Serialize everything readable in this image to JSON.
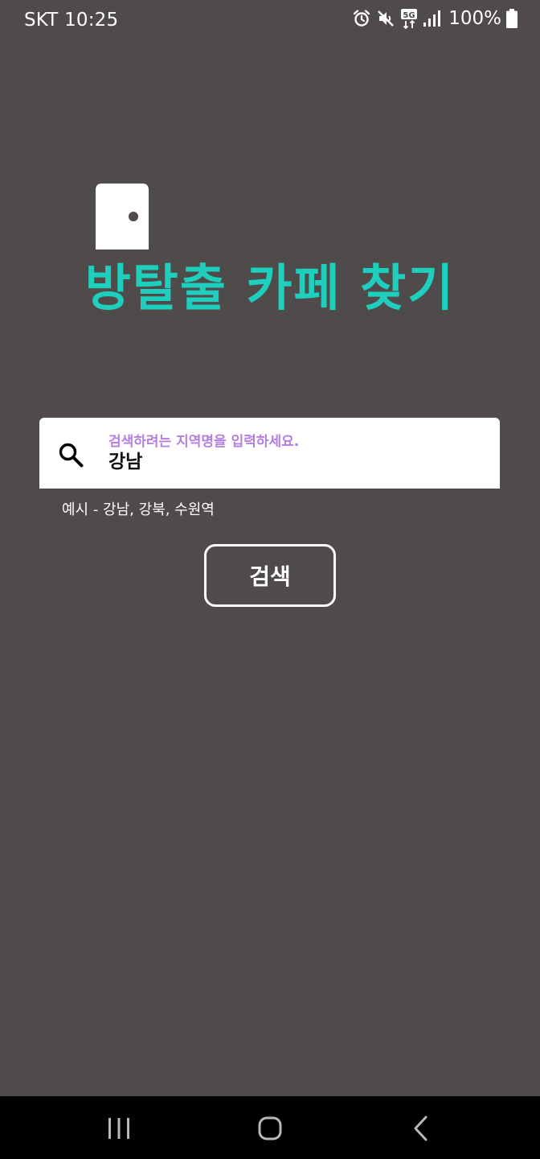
{
  "status_bar": {
    "carrier": "SKT",
    "time": "10:25",
    "network": "5G",
    "battery": "100%",
    "icons": [
      "alarm-icon",
      "mute-icon",
      "5g-icon",
      "signal-icon",
      "battery-icon"
    ]
  },
  "app": {
    "title": "방탈출 카페 찾기",
    "logo_icon": "door-icon"
  },
  "search": {
    "label": "검색하려는 지역명을 입력하세요.",
    "value": "강남",
    "helper": "예시 - 강남, 강북, 수원역",
    "button_label": "검색",
    "icon": "search-icon"
  },
  "navigation": {
    "items": [
      "recent-apps-icon",
      "home-icon",
      "back-icon"
    ]
  },
  "colors": {
    "background": "#4f4b4a",
    "accent": "#1ecfbd",
    "label": "#b57fe0",
    "nav_bar": "#000000"
  }
}
